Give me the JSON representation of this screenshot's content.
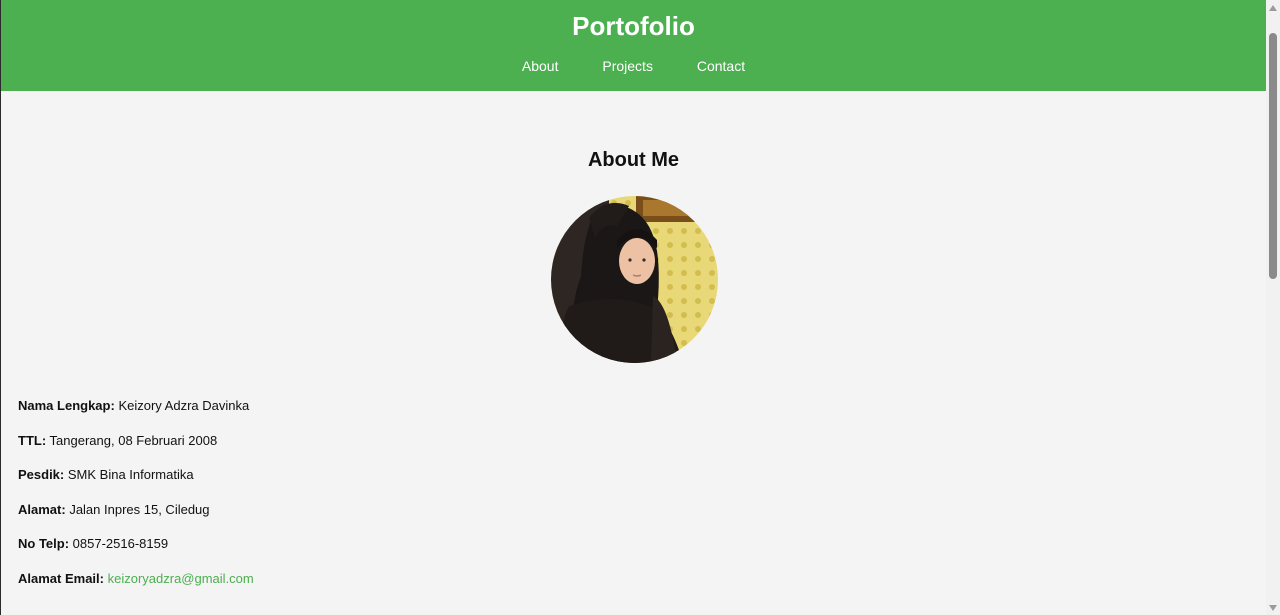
{
  "header": {
    "title": "Portofolio",
    "nav": [
      {
        "label": "About"
      },
      {
        "label": "Projects"
      },
      {
        "label": "Contact"
      }
    ]
  },
  "about": {
    "heading": "About Me",
    "fields": [
      {
        "label": "Nama Lengkap:",
        "value": "Keizory Adzra Davinka"
      },
      {
        "label": "TTL:",
        "value": "Tangerang, 08 Februari 2008"
      },
      {
        "label": "Pesdik:",
        "value": "SMK Bina Informatika"
      },
      {
        "label": "Alamat:",
        "value": "Jalan Inpres 15, Ciledug"
      },
      {
        "label": "No Telp:",
        "value": "0857-2516-8159"
      },
      {
        "label": "Alamat Email:",
        "value": "keizoryadzra@gmail.com"
      }
    ]
  },
  "colors": {
    "header_bg": "#4caf50",
    "link": "#4caf50",
    "page_bg": "#f4f4f4"
  }
}
